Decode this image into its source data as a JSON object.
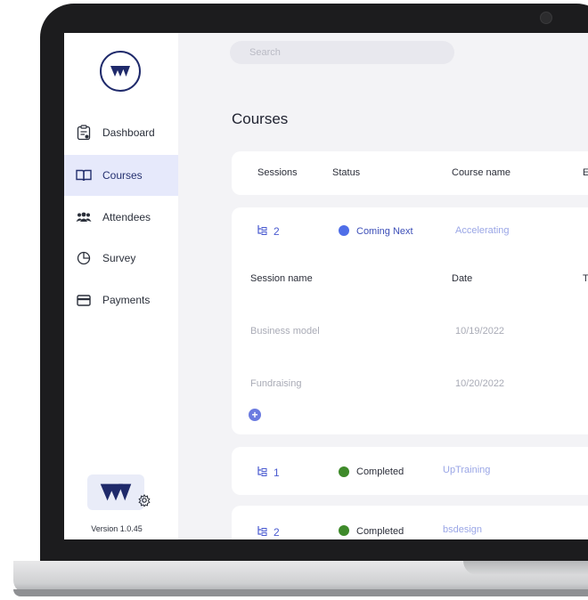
{
  "app": {
    "version": "Version 1.0.45",
    "search_placeholder": "Search",
    "page_title": "Courses"
  },
  "sidebar": {
    "items": [
      {
        "label": "Dashboard",
        "icon": "clipboard-icon",
        "active": false
      },
      {
        "label": "Courses",
        "icon": "book-open-icon",
        "active": true
      },
      {
        "label": "Attendees",
        "icon": "people-icon",
        "active": false
      },
      {
        "label": "Survey",
        "icon": "pie-chart-icon",
        "active": false
      },
      {
        "label": "Payments",
        "icon": "credit-card-icon",
        "active": false
      }
    ]
  },
  "table": {
    "headers": {
      "sessions": "Sessions",
      "status": "Status",
      "course": "Course name",
      "extra": "E"
    },
    "courses": [
      {
        "sessions": "2",
        "status": "Coming Next",
        "status_color": "#4f6ee8",
        "name": "Accelerating"
      },
      {
        "sessions": "1",
        "status": "Completed",
        "status_color": "#3e8a2a",
        "name": "UpTraining"
      },
      {
        "sessions": "2",
        "status": "Completed",
        "status_color": "#3e8a2a",
        "name": "bsdesign"
      }
    ],
    "session_headers": {
      "name": "Session name",
      "date": "Date",
      "extra": "T"
    },
    "sessions": [
      {
        "name": "Business model",
        "date": "10/19/2022"
      },
      {
        "name": "Fundraising",
        "date": "10/20/2022"
      }
    ]
  },
  "colors": {
    "accent": "#4a5bd0",
    "brand": "#1f2a6b",
    "active_bg": "#e6e9fb"
  }
}
